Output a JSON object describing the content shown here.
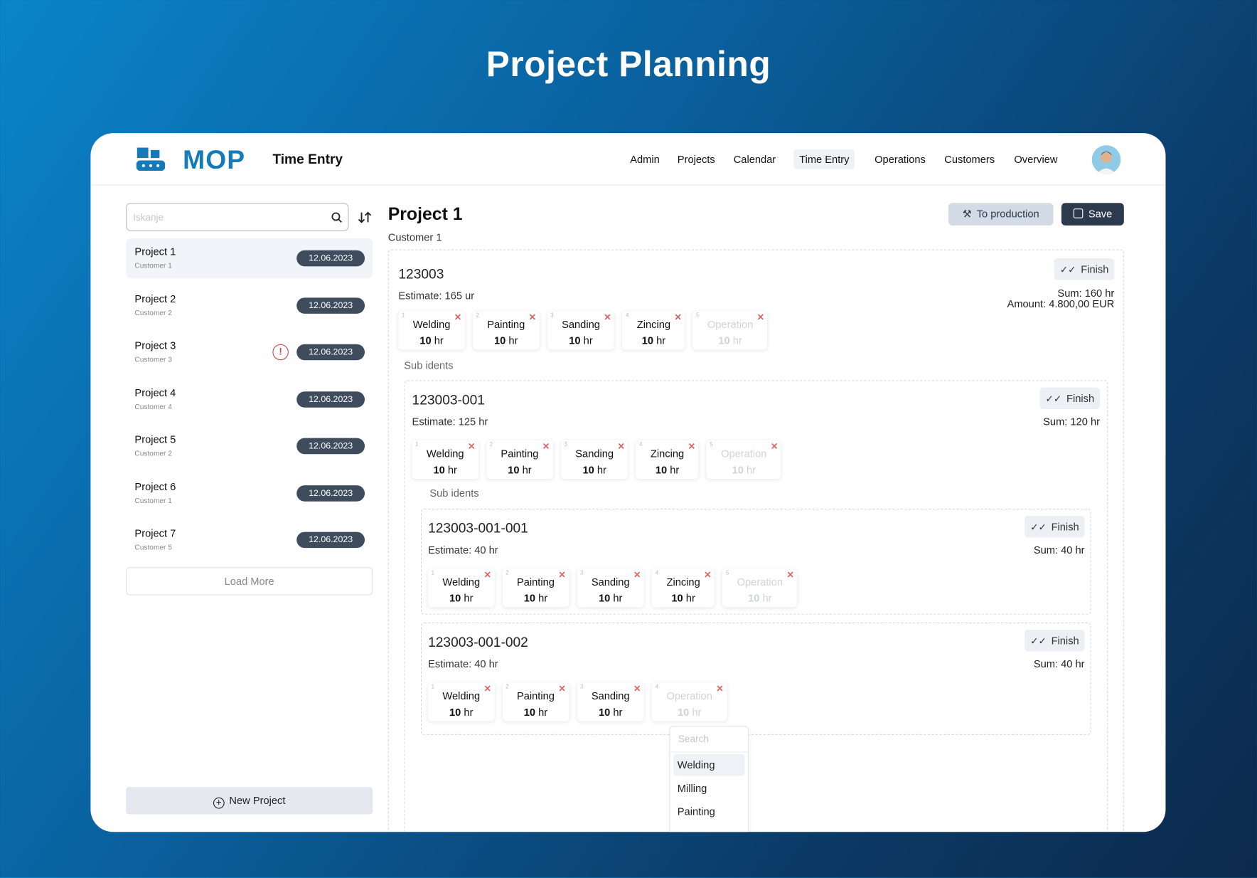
{
  "hero_title": "Project Planning",
  "app": {
    "logo": "MOP",
    "title": "Time Entry",
    "brand_color": "#157ab9"
  },
  "nav": {
    "items": [
      {
        "label": "Admin"
      },
      {
        "label": "Projects"
      },
      {
        "label": "Calendar"
      },
      {
        "label": "Time Entry",
        "active": true
      },
      {
        "label": "Operations"
      },
      {
        "label": "Customers"
      },
      {
        "label": "Overview"
      }
    ]
  },
  "sidebar": {
    "search_placeholder": "Iskanje",
    "projects": [
      {
        "name": "Project 1",
        "customer": "Customer 1",
        "date": "12.06.2023",
        "selected": true
      },
      {
        "name": "Project 2",
        "customer": "Customer 2",
        "date": "12.06.2023"
      },
      {
        "name": "Project 3",
        "customer": "Customer 3",
        "date": "12.06.2023",
        "warning": true
      },
      {
        "name": "Project 4",
        "customer": "Customer 4",
        "date": "12.06.2023"
      },
      {
        "name": "Project 5",
        "customer": "Customer 2",
        "date": "12.06.2023"
      },
      {
        "name": "Project 6",
        "customer": "Customer 1",
        "date": "12.06.2023"
      },
      {
        "name": "Project 7",
        "customer": "Customer 5",
        "date": "12.06.2023"
      }
    ],
    "load_more": "Load More",
    "new_project": "New Project"
  },
  "main": {
    "title": "Project 1",
    "customer": "Customer 1",
    "to_production": "To production",
    "save": "Save",
    "finish_label": "Finish",
    "sub_idents_label": "Sub idents",
    "root": {
      "ident": "123003",
      "estimate": "Estimate: 165 ur",
      "sum": "Sum: 160 hr",
      "amount": "Amount: 4.800,00 EUR",
      "ops": [
        {
          "n": "1",
          "name": "Welding",
          "hours": "10",
          "unit": "hr"
        },
        {
          "n": "2",
          "name": "Painting",
          "hours": "10",
          "unit": "hr"
        },
        {
          "n": "3",
          "name": "Sanding",
          "hours": "10",
          "unit": "hr"
        },
        {
          "n": "4",
          "name": "Zincing",
          "hours": "10",
          "unit": "hr"
        },
        {
          "n": "5",
          "name": "Operation",
          "hours": "10",
          "unit": "hr",
          "placeholder": true
        }
      ]
    },
    "sub1": {
      "ident": "123003-001",
      "estimate": "Estimate: 125 hr",
      "sum": "Sum: 120 hr",
      "ops": [
        {
          "n": "1",
          "name": "Welding",
          "hours": "10",
          "unit": "hr"
        },
        {
          "n": "2",
          "name": "Painting",
          "hours": "10",
          "unit": "hr"
        },
        {
          "n": "3",
          "name": "Sanding",
          "hours": "10",
          "unit": "hr"
        },
        {
          "n": "4",
          "name": "Zincing",
          "hours": "10",
          "unit": "hr"
        },
        {
          "n": "5",
          "name": "Operation",
          "hours": "10",
          "unit": "hr",
          "placeholder": true
        }
      ]
    },
    "sub2": {
      "ident": "123003-001-001",
      "estimate": "Estimate: 40 hr",
      "sum": "Sum: 40 hr",
      "ops": [
        {
          "n": "1",
          "name": "Welding",
          "hours": "10",
          "unit": "hr"
        },
        {
          "n": "2",
          "name": "Painting",
          "hours": "10",
          "unit": "hr"
        },
        {
          "n": "3",
          "name": "Sanding",
          "hours": "10",
          "unit": "hr"
        },
        {
          "n": "4",
          "name": "Zincing",
          "hours": "10",
          "unit": "hr"
        },
        {
          "n": "5",
          "name": "Operation",
          "hours": "10",
          "unit": "hr",
          "placeholder": true
        }
      ]
    },
    "sub3": {
      "ident": "123003-001-002",
      "estimate": "Estimate: 40 hr",
      "sum": "Sum: 40 hr",
      "ops": [
        {
          "n": "1",
          "name": "Welding",
          "hours": "10",
          "unit": "hr"
        },
        {
          "n": "2",
          "name": "Painting",
          "hours": "10",
          "unit": "hr"
        },
        {
          "n": "3",
          "name": "Sanding",
          "hours": "10",
          "unit": "hr"
        },
        {
          "n": "4",
          "name": "Operation",
          "hours": "10",
          "unit": "hr",
          "placeholder": true
        }
      ]
    },
    "dropdown": {
      "search_placeholder": "Search",
      "options": [
        "Welding",
        "Milling",
        "Painting"
      ],
      "highlighted": "Welding"
    }
  }
}
